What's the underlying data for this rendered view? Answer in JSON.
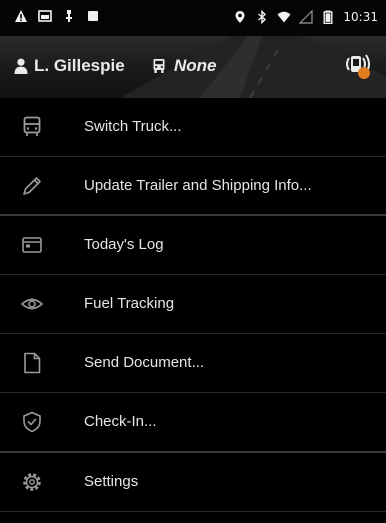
{
  "status_bar": {
    "icons_left": [
      "warning-icon",
      "gallery-icon",
      "usb-icon",
      "square-icon"
    ],
    "icons_right": [
      "location-icon",
      "bluetooth-icon",
      "wifi-icon",
      "no-signal-icon",
      "battery-icon"
    ],
    "time": "10:31"
  },
  "header": {
    "user_name": "L. Gillespie",
    "truck_value": "None",
    "signal_badge_color": "#e07b1f"
  },
  "menu": {
    "items": [
      {
        "label": "Switch Truck...",
        "icon": "truck-icon"
      },
      {
        "label": "Update Trailer and Shipping Info...",
        "icon": "pencil-icon"
      },
      {
        "label": "Today's Log",
        "icon": "log-icon"
      },
      {
        "label": "Fuel Tracking",
        "icon": "eye-icon"
      },
      {
        "label": "Send Document...",
        "icon": "document-icon"
      },
      {
        "label": "Check-In...",
        "icon": "shield-check-icon"
      },
      {
        "label": "Settings",
        "icon": "gear-icon"
      }
    ]
  }
}
